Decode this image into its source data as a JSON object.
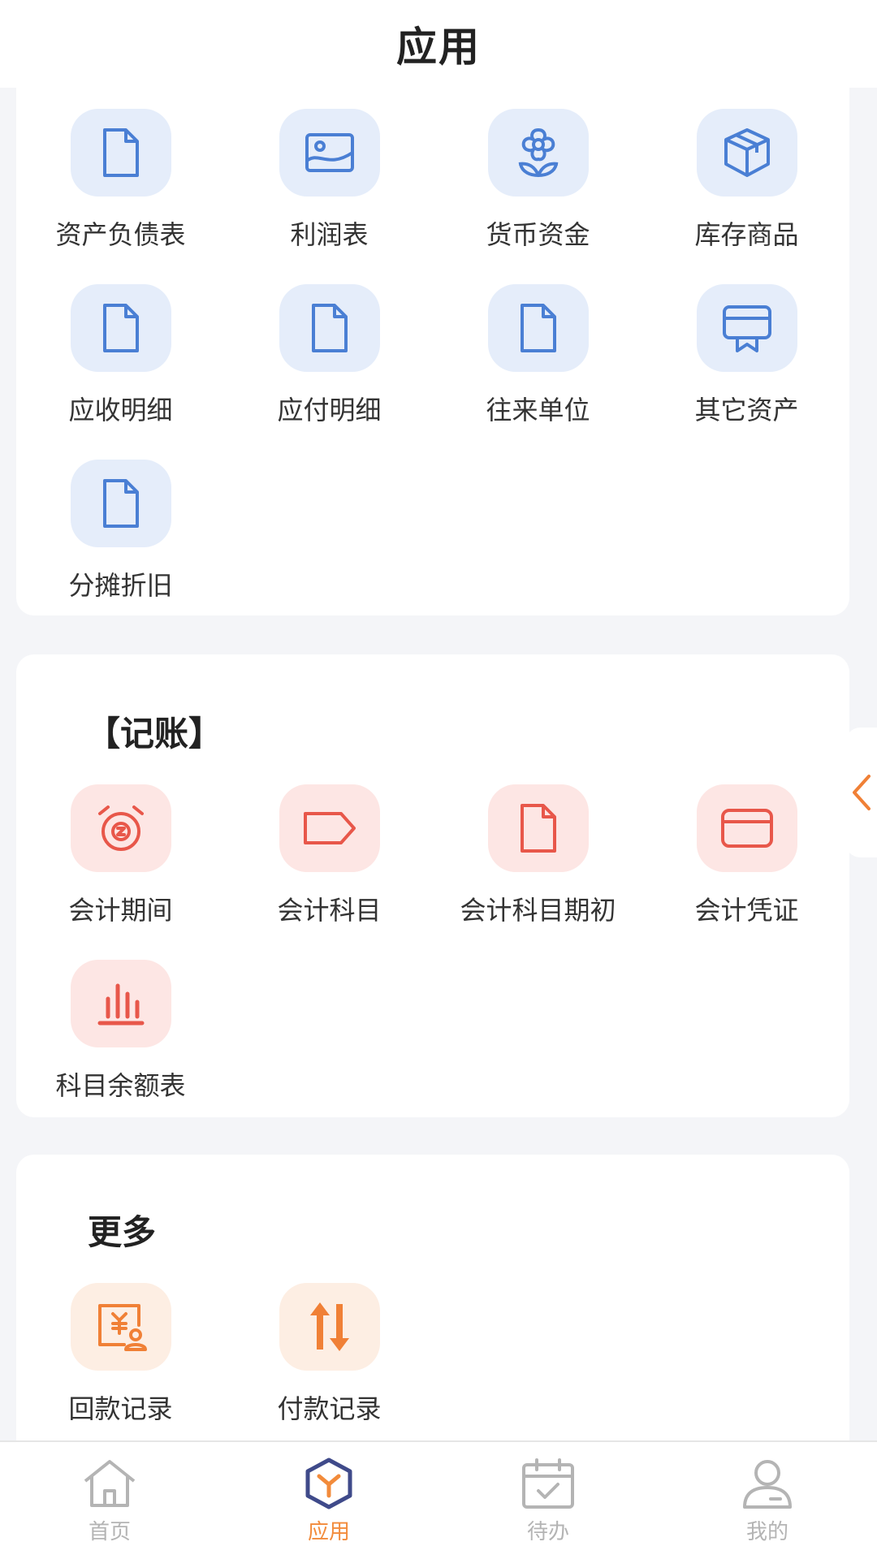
{
  "header": {
    "title": "应用"
  },
  "section1": {
    "items": [
      {
        "label": "资产负债表",
        "icon": "document-icon"
      },
      {
        "label": "利润表",
        "icon": "image-icon"
      },
      {
        "label": "货币资金",
        "icon": "flower-icon"
      },
      {
        "label": "库存商品",
        "icon": "box-icon"
      },
      {
        "label": "应收明细",
        "icon": "document-icon"
      },
      {
        "label": "应付明细",
        "icon": "document-icon"
      },
      {
        "label": "往来单位",
        "icon": "document-icon"
      },
      {
        "label": "其它资产",
        "icon": "ribbon-icon"
      },
      {
        "label": "分摊折旧",
        "icon": "document-icon"
      }
    ]
  },
  "section2": {
    "title": "【记账】",
    "items": [
      {
        "label": "会计期间",
        "icon": "alarm-clock-icon"
      },
      {
        "label": "会计科目",
        "icon": "tag-icon"
      },
      {
        "label": "会计科目期初",
        "icon": "document-icon"
      },
      {
        "label": "会计凭证",
        "icon": "card-icon"
      },
      {
        "label": "科目余额表",
        "icon": "bar-chart-icon"
      }
    ]
  },
  "section3": {
    "title": "更多",
    "items": [
      {
        "label": "回款记录",
        "icon": "payment-receipt-icon"
      },
      {
        "label": "付款记录",
        "icon": "transfer-arrows-icon"
      }
    ]
  },
  "tabbar": {
    "tabs": [
      {
        "label": "首页",
        "icon": "home-icon",
        "active": false
      },
      {
        "label": "应用",
        "icon": "cube-icon",
        "active": true
      },
      {
        "label": "待办",
        "icon": "calendar-check-icon",
        "active": false
      },
      {
        "label": "我的",
        "icon": "user-icon",
        "active": false
      }
    ]
  },
  "colors": {
    "blue": "#4a7fd4",
    "red": "#e8574a",
    "orange": "#f08036",
    "active_tab": "#f28b3b",
    "inactive_tab": "#b4b4b4"
  }
}
